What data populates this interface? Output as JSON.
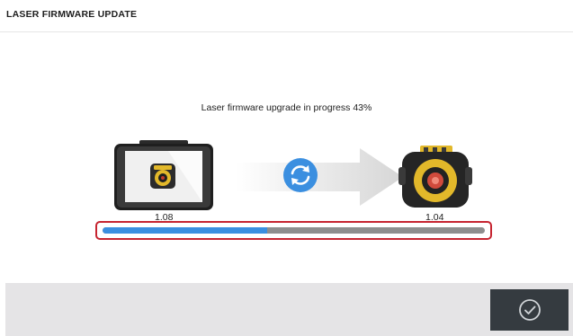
{
  "header": {
    "title": "LASER FIRMWARE UPDATE"
  },
  "status": {
    "message": "Laser firmware upgrade in progress 43%",
    "progress_fraction": 0.43
  },
  "devices": {
    "source": {
      "icon": "tablet-device-icon",
      "version": "1.08"
    },
    "target": {
      "icon": "laser-sensor-icon",
      "version": "1.04"
    },
    "transfer_icon": "sync-icon"
  },
  "colors": {
    "progress_fill": "#3b8fe0",
    "progress_track": "#8e8e8e",
    "highlight_border": "#c62430",
    "footer_bg": "#e5e4e6",
    "confirm_button_bg": "#353b40"
  },
  "footer": {
    "confirm_icon": "check-circle-icon"
  }
}
